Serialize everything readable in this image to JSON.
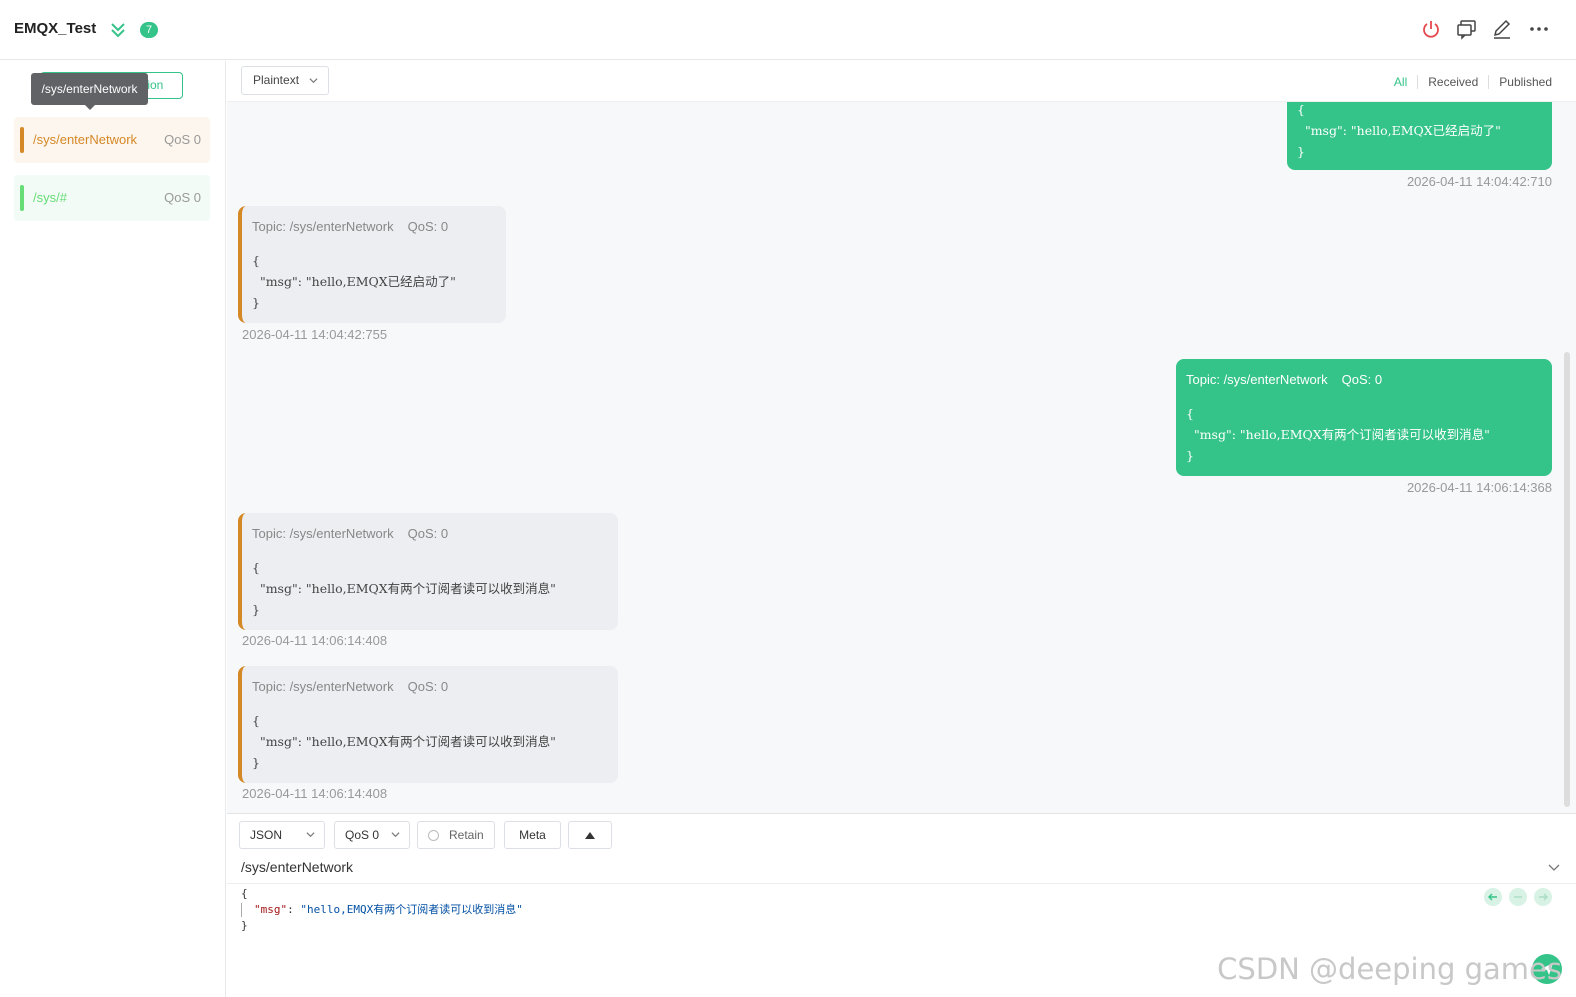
{
  "header": {
    "connection_name": "EMQX_Test",
    "unread_count": "7",
    "icons": [
      "toggle-collapse-icon",
      "power-icon",
      "chat-icon",
      "edit-icon",
      "more-icon"
    ]
  },
  "sidebar": {
    "new_subscription_label": "+ New Subscription",
    "tooltip_text": "/sys/enterNetwork",
    "subscriptions": [
      {
        "topic": "/sys/enterNetwork",
        "qos": "QoS 0",
        "color": "#d58826"
      },
      {
        "topic": "/sys/#",
        "qos": "QoS 0",
        "color": "#66dd77"
      }
    ]
  },
  "toolbar": {
    "payload_type": "Plaintext",
    "filters": [
      "All",
      "Received",
      "Published"
    ],
    "active_filter": "All"
  },
  "messages": [
    {
      "type": "published",
      "topic_label": "",
      "qos_label": "",
      "payload_lines": [
        "{",
        "  \"msg\": \"hello,EMQX已经启动了\"",
        "}"
      ],
      "timestamp": "2026-04-11 14:04:42:710"
    },
    {
      "type": "received",
      "topic_label": "Topic: /sys/enterNetwork",
      "qos_label": "QoS: 0",
      "payload_lines": [
        "{",
        "  \"msg\": \"hello,EMQX已经启动了\"",
        "}"
      ],
      "timestamp": "2026-04-11 14:04:42:755"
    },
    {
      "type": "published",
      "topic_label": "Topic: /sys/enterNetwork",
      "qos_label": "QoS: 0",
      "payload_lines": [
        "{",
        "  \"msg\": \"hello,EMQX有两个订阅者读可以收到消息\"",
        "}"
      ],
      "timestamp": "2026-04-11 14:06:14:368"
    },
    {
      "type": "received",
      "topic_label": "Topic: /sys/enterNetwork",
      "qos_label": "QoS: 0",
      "payload_lines": [
        "{",
        "  \"msg\": \"hello,EMQX有两个订阅者读可以收到消息\"",
        "}"
      ],
      "timestamp": "2026-04-11 14:06:14:408"
    },
    {
      "type": "received",
      "topic_label": "Topic: /sys/enterNetwork",
      "qos_label": "QoS: 0",
      "payload_lines": [
        "{",
        "  \"msg\": \"hello,EMQX有两个订阅者读可以收到消息\"",
        "}"
      ],
      "timestamp": "2026-04-11 14:06:14:408"
    }
  ],
  "composer": {
    "format": "JSON",
    "qos": "QoS 0",
    "retain_label": "Retain",
    "meta_label": "Meta",
    "topic": "/sys/enterNetwork",
    "payload": {
      "open": "{",
      "key": "\"msg\"",
      "colon": ": ",
      "value": "\"hello,EMQX有两个订阅者读可以收到消息\"",
      "close": "}"
    }
  },
  "watermark": "CSDN @deeping games",
  "colors": {
    "accent": "#34c388",
    "received_bar": "#d58826"
  }
}
